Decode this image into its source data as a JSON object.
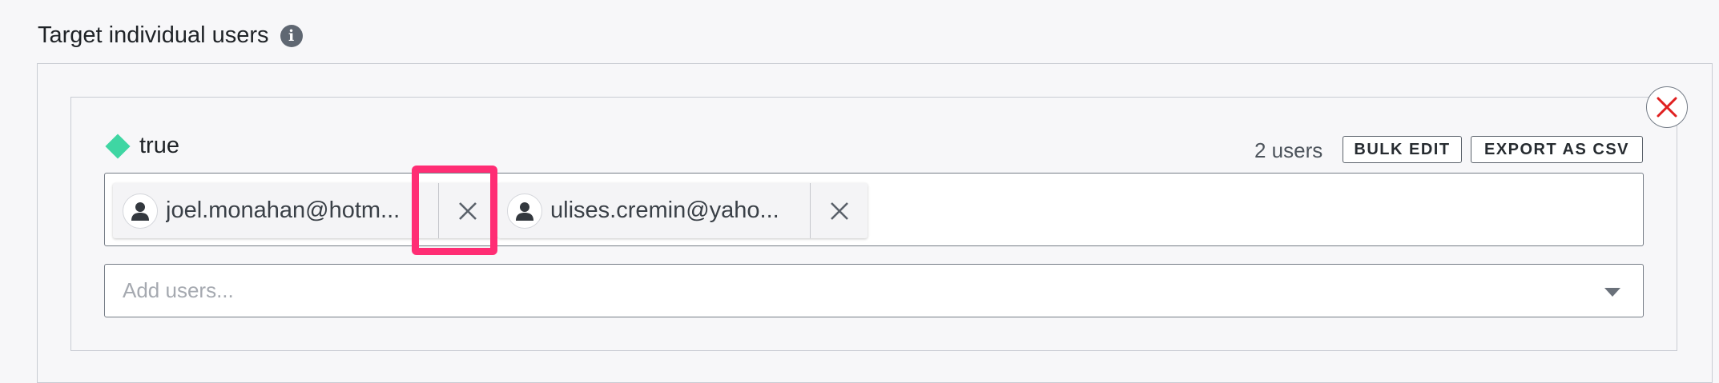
{
  "section": {
    "title": "Target individual users",
    "info_icon": "info-icon"
  },
  "rule": {
    "variation_label": "true",
    "variation_color": "#3fd6a3",
    "user_count": "2 users",
    "bulk_edit_label": "BULK EDIT",
    "export_label": "EXPORT AS CSV",
    "remove_icon": "close-circle-icon",
    "remove_icon_color": "#e02020",
    "users": [
      {
        "label": "joel.monahan@hotm...",
        "icon": "user-icon"
      },
      {
        "label": "ulises.cremin@yaho...",
        "icon": "user-icon"
      }
    ],
    "add_users_placeholder": "Add users..."
  },
  "highlight_color": "#ff2d74"
}
